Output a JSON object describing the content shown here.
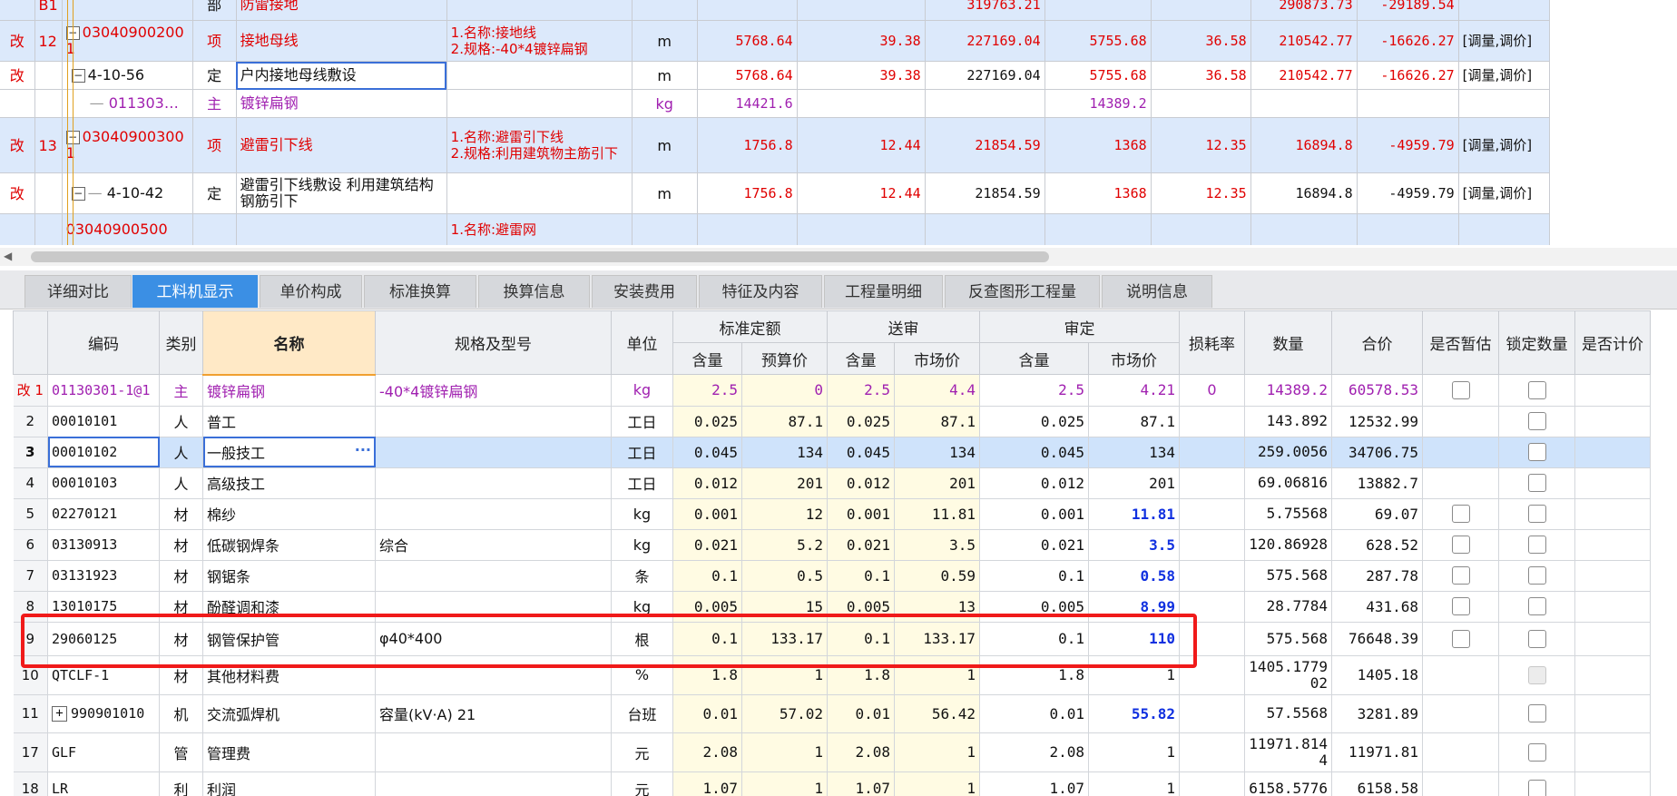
{
  "top_rows": [
    {
      "mark": "",
      "no": "B1",
      "code": "",
      "type": "部",
      "name": "防雷接地",
      "spec": "",
      "unit": "",
      "qty": "",
      "price": "",
      "total": "319763.21",
      "qty2": "",
      "price2": "",
      "total2": "290873.73",
      "diff": "-29189.54",
      "note": ""
    },
    {
      "mark": "改",
      "no": "12",
      "code": "030409002001",
      "type": "项",
      "name": "接地母线",
      "spec": "1.名称:接地线\n2.规格:-40*4镀锌扁钢",
      "unit": "m",
      "qty": "5768.64",
      "price": "39.38",
      "total": "227169.04",
      "qty2": "5755.68",
      "price2": "36.58",
      "total2": "210542.77",
      "diff": "-16626.27",
      "note": "[调量,调价]"
    },
    {
      "mark": "改",
      "no": "",
      "code": "4-10-56",
      "type": "定",
      "name": "户内接地母线敷设",
      "spec": "",
      "unit": "m",
      "qty": "5768.64",
      "price": "39.38",
      "total": "227169.04",
      "qty2": "5755.68",
      "price2": "36.58",
      "total2": "210542.77",
      "diff": "-16626.27",
      "note": "[调量,调价]"
    },
    {
      "mark": "",
      "no": "",
      "code": "011303…",
      "type": "主",
      "name": "镀锌扁钢",
      "spec": "",
      "unit": "kg",
      "qty": "14421.6",
      "price": "",
      "total": "",
      "qty2": "14389.2",
      "price2": "",
      "total2": "",
      "diff": "",
      "note": ""
    },
    {
      "mark": "改",
      "no": "13",
      "code": "030409003001",
      "type": "项",
      "name": "避雷引下线",
      "spec": "1.名称:避雷引下线\n2.规格:利用建筑物主筋引下",
      "unit": "m",
      "qty": "1756.8",
      "price": "12.44",
      "total": "21854.59",
      "qty2": "1368",
      "price2": "12.35",
      "total2": "16894.8",
      "diff": "-4959.79",
      "note": "[调量,调价]"
    },
    {
      "mark": "改",
      "no": "",
      "code": "4-10-42",
      "type": "定",
      "name": "避雷引下线敷设 利用建筑结构钢筋引下",
      "spec": "",
      "unit": "m",
      "qty": "1756.8",
      "price": "12.44",
      "total": "21854.59",
      "qty2": "1368",
      "price2": "12.35",
      "total2": "16894.8",
      "diff": "-4959.79",
      "note": "[调量,调价]"
    },
    {
      "mark": "",
      "no": "",
      "code": "03040900500",
      "type": "",
      "name": "",
      "spec": "1.名称:避雷网",
      "unit": "",
      "qty": "",
      "price": "",
      "total": "",
      "qty2": "",
      "price2": "",
      "total2": "",
      "diff": "",
      "note": ""
    }
  ],
  "tabs": [
    "详细对比",
    "工料机显示",
    "单价构成",
    "标准换算",
    "换算信息",
    "安装费用",
    "特征及内容",
    "工程量明细",
    "反查图形工程量",
    "说明信息"
  ],
  "active_tab": "工料机显示",
  "headers": {
    "code": "编码",
    "type": "类别",
    "name": "名称",
    "spec": "规格及型号",
    "unit": "单位",
    "group_std": "标准定额",
    "group_sub": "送审",
    "group_app": "审定",
    "qty": "含量",
    "budget_price": "预算价",
    "market_price": "市场价",
    "loss": "损耗率",
    "amount": "数量",
    "total": "合价",
    "is_temp": "是否暂估",
    "lock_qty": "锁定数量",
    "is_price": "是否计价"
  },
  "rows": [
    {
      "no": "改 1",
      "code": "01130301-1@1",
      "type": "主",
      "name": "镀锌扁钢",
      "spec": "-40*4镀锌扁钢",
      "unit": "kg",
      "q1": "2.5",
      "p1": "0",
      "q2": "2.5",
      "p2": "4.4",
      "q3": "2.5",
      "p3": "4.21",
      "loss": "0",
      "amount": "14389.2",
      "total": "60578.53"
    },
    {
      "no": "2",
      "code": "00010101",
      "type": "人",
      "name": "普工",
      "spec": "",
      "unit": "工日",
      "q1": "0.025",
      "p1": "87.1",
      "q2": "0.025",
      "p2": "87.1",
      "q3": "0.025",
      "p3": "87.1",
      "loss": "",
      "amount": "143.892",
      "total": "12532.99"
    },
    {
      "no": "3",
      "code": "00010102",
      "type": "人",
      "name": "一般技工",
      "spec": "",
      "unit": "工日",
      "q1": "0.045",
      "p1": "134",
      "q2": "0.045",
      "p2": "134",
      "q3": "0.045",
      "p3": "134",
      "loss": "",
      "amount": "259.0056",
      "total": "34706.75"
    },
    {
      "no": "4",
      "code": "00010103",
      "type": "人",
      "name": "高级技工",
      "spec": "",
      "unit": "工日",
      "q1": "0.012",
      "p1": "201",
      "q2": "0.012",
      "p2": "201",
      "q3": "0.012",
      "p3": "201",
      "loss": "",
      "amount": "69.06816",
      "total": "13882.7"
    },
    {
      "no": "5",
      "code": "02270121",
      "type": "材",
      "name": "棉纱",
      "spec": "",
      "unit": "kg",
      "q1": "0.001",
      "p1": "12",
      "q2": "0.001",
      "p2": "11.81",
      "q3": "0.001",
      "p3": "11.81",
      "loss": "",
      "amount": "5.75568",
      "total": "69.07"
    },
    {
      "no": "6",
      "code": "03130913",
      "type": "材",
      "name": "低碳钢焊条",
      "spec": "综合",
      "unit": "kg",
      "q1": "0.021",
      "p1": "5.2",
      "q2": "0.021",
      "p2": "3.5",
      "q3": "0.021",
      "p3": "3.5",
      "loss": "",
      "amount": "120.86928",
      "total": "628.52"
    },
    {
      "no": "7",
      "code": "03131923",
      "type": "材",
      "name": "钢锯条",
      "spec": "",
      "unit": "条",
      "q1": "0.1",
      "p1": "0.5",
      "q2": "0.1",
      "p2": "0.59",
      "q3": "0.1",
      "p3": "0.58",
      "loss": "",
      "amount": "575.568",
      "total": "287.78"
    },
    {
      "no": "8",
      "code": "13010175",
      "type": "材",
      "name": "酚醛调和漆",
      "spec": "",
      "unit": "kg",
      "q1": "0.005",
      "p1": "15",
      "q2": "0.005",
      "p2": "13",
      "q3": "0.005",
      "p3": "8.99",
      "loss": "",
      "amount": "28.7784",
      "total": "431.68"
    },
    {
      "no": "9",
      "code": "29060125",
      "type": "材",
      "name": "钢管保护管",
      "spec": "φ40*400",
      "unit": "根",
      "q1": "0.1",
      "p1": "133.17",
      "q2": "0.1",
      "p2": "133.17",
      "q3": "0.1",
      "p3": "110",
      "loss": "",
      "amount": "575.568",
      "total": "76648.39"
    },
    {
      "no": "10",
      "code": "QTCLF-1",
      "type": "材",
      "name": "其他材料费",
      "spec": "",
      "unit": "%",
      "q1": "1.8",
      "p1": "1",
      "q2": "1.8",
      "p2": "1",
      "q3": "1.8",
      "p3": "1",
      "loss": "",
      "amount": "1405.177902",
      "total": "1405.18"
    },
    {
      "no": "11",
      "code": "990901010",
      "type": "机",
      "name": "交流弧焊机",
      "spec": "容量(kV·A) 21",
      "unit": "台班",
      "q1": "0.01",
      "p1": "57.02",
      "q2": "0.01",
      "p2": "56.42",
      "q3": "0.01",
      "p3": "55.82",
      "loss": "",
      "amount": "57.5568",
      "total": "3281.89"
    },
    {
      "no": "17",
      "code": "GLF",
      "type": "管",
      "name": "管理费",
      "spec": "",
      "unit": "元",
      "q1": "2.08",
      "p1": "1",
      "q2": "2.08",
      "p2": "1",
      "q3": "2.08",
      "p3": "1",
      "loss": "",
      "amount": "11971.8144",
      "total": "11971.81"
    },
    {
      "no": "18",
      "code": "LR",
      "type": "利",
      "name": "利润",
      "spec": "",
      "unit": "元",
      "q1": "1.07",
      "p1": "1",
      "q2": "1.07",
      "p2": "1",
      "q3": "1.07",
      "p3": "1",
      "loss": "",
      "amount": "6158.5776",
      "total": "6158.58"
    }
  ],
  "colors": {
    "tab_active": "#3b8fe4",
    "highlight": "#f01a1a",
    "changed_mark": "#e00000",
    "main_material": "#a020b0",
    "adjusted_price": "#1030e0"
  }
}
